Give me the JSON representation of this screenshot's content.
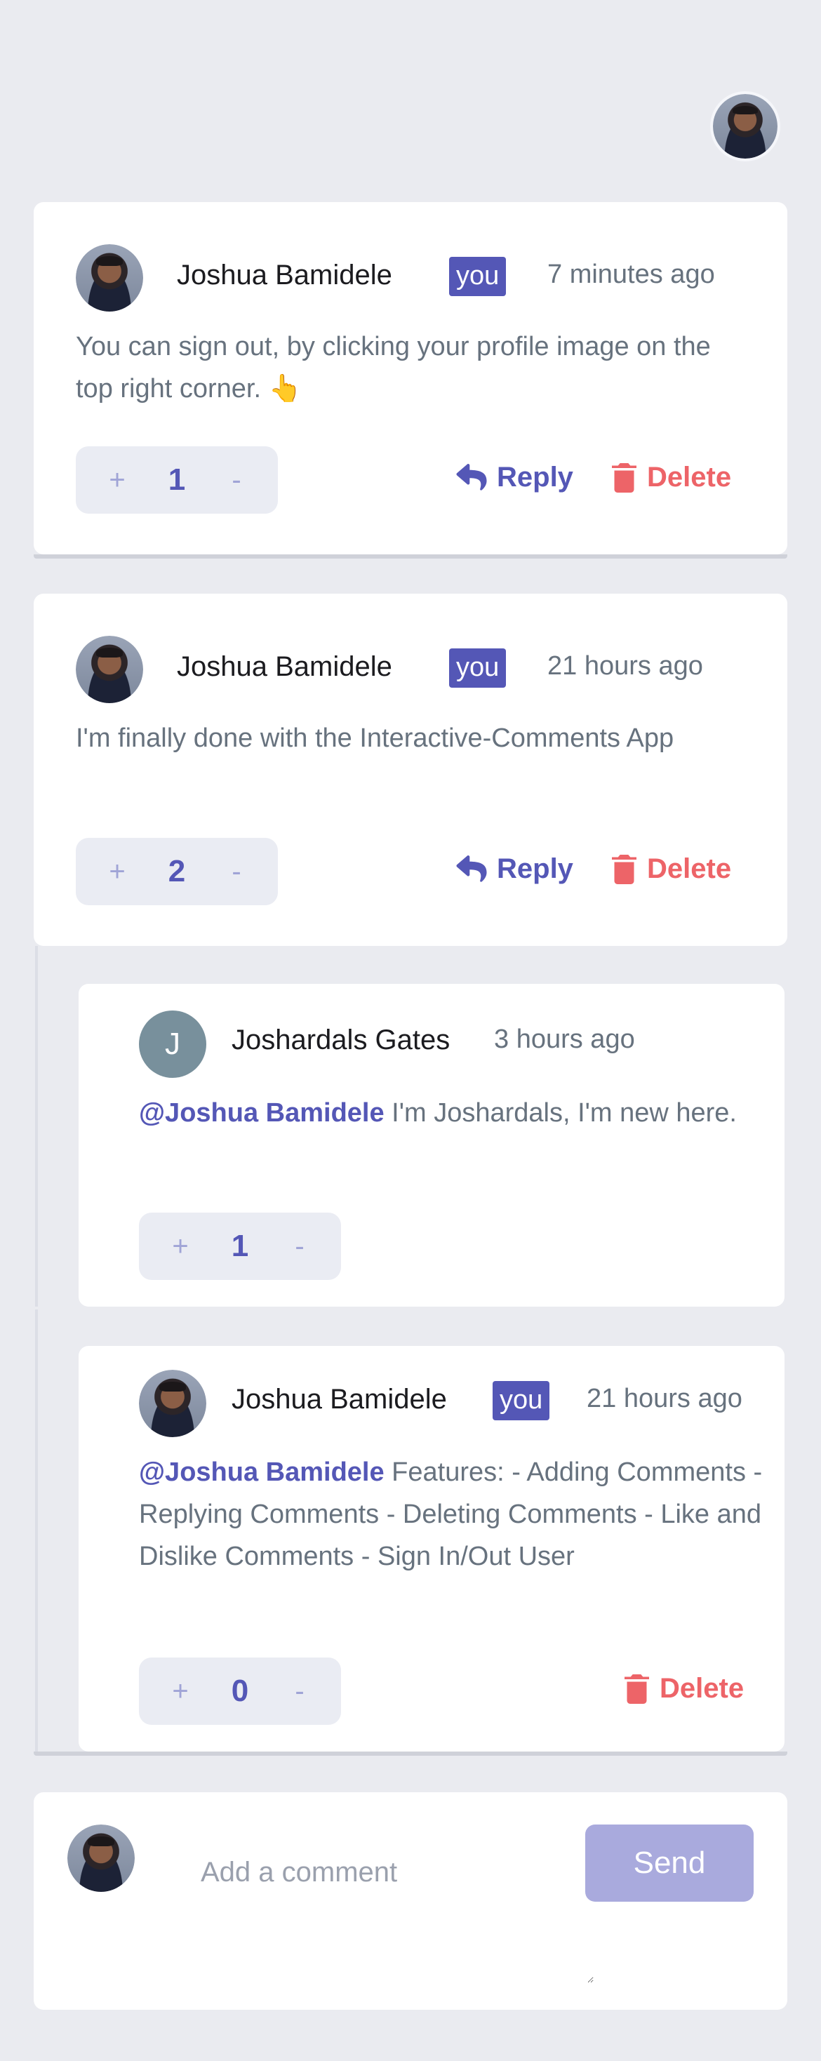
{
  "current_user": {
    "name": "Joshua Bamidele"
  },
  "badge_you": "you",
  "labels": {
    "reply": "Reply",
    "delete": "Delete",
    "plus": "+",
    "minus": "-"
  },
  "comments": [
    {
      "user": "Joshua Bamidele",
      "you": true,
      "time": "7 minutes ago",
      "text": "You can sign out, by clicking your profile image on the top right corner. 👆",
      "score": "1"
    },
    {
      "user": "Joshua Bamidele",
      "you": true,
      "time": "21 hours ago",
      "text": "I'm finally done with the Interactive-Comments App",
      "score": "2",
      "replies": [
        {
          "user": "Joshardals Gates",
          "avatar_letter": "J",
          "time": "3 hours ago",
          "mention": "@Joshua Bamidele",
          "text": " I'm Joshardals, I'm new here.",
          "score": "1"
        },
        {
          "user": "Joshua Bamidele",
          "you": true,
          "time": "21 hours ago",
          "mention": "@Joshua Bamidele",
          "text": " Features: - Adding Comments - Replying Comments - Deleting Comments - Like and Dislike Comments - Sign In/Out User",
          "score": "0"
        }
      ]
    }
  ],
  "composer": {
    "placeholder": "Add a comment",
    "send_label": "Send"
  },
  "colors": {
    "accent": "#5457b6",
    "danger": "#ed6468",
    "background": "#eaebf0"
  }
}
